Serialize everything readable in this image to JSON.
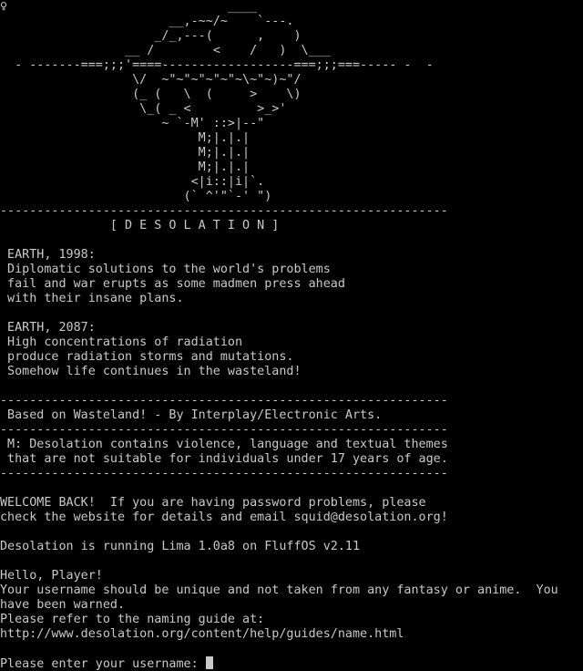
{
  "colors": {
    "background": "#000000",
    "foreground": "#c9c9c9"
  },
  "terminal": {
    "lines": [
      "♀                              ____",
      "                       __,-~~/~    `---.",
      "                     _/_,---(      ,    )",
      "                 __ /        <    /   )  \\___",
      "  - -------===;;;'====------------------===;;;===----- -  -",
      "                  \\/  ~\"~\"~\"~\"~\"~\\~\"~)~\"/",
      "                  (_ (   \\  (     >    \\)",
      "                   \\_( _ <         >_>'",
      "                      ~ `-M' ::>|--\"",
      "                           M;|.|.|",
      "                           M;|.|.|",
      "                           M;|.|.|",
      "                          <|i::|i|`.",
      "                         (` ^'\"`-' \")",
      "-------------------------------------------------------------",
      "               [ D E S O L A T I O N ]",
      "",
      " EARTH, 1998:",
      " Diplomatic solutions to the world's problems",
      " fail and war erupts as some madmen press ahead",
      " with their insane plans.",
      "",
      " EARTH, 2087:",
      " High concentrations of radiation",
      " produce radiation storms and mutations.",
      " Somehow life continues in the wasteland!",
      "",
      "-------------------------------------------------------------",
      " Based on Wasteland! - By Interplay/Electronic Arts.",
      "-------------------------------------------------------------",
      " M: Desolation contains violence, language and textual themes",
      " that are not suitable for individuals under 17 years of age.",
      "-------------------------------------------------------------",
      "",
      "WELCOME BACK!  If you are having password problems, please",
      "check the website for details and email squid@desolation.org!",
      "",
      "Desolation is running Lima 1.0a8 on FluffOS v2.11",
      "",
      "Hello, Player!",
      "Your username should be unique and not taken from any fantasy or anime.  You",
      "have been warned.",
      "Please refer to the naming guide at:",
      "http://www.desolation.org/content/help/guides/name.html",
      "",
      "Please enter your username: "
    ]
  }
}
